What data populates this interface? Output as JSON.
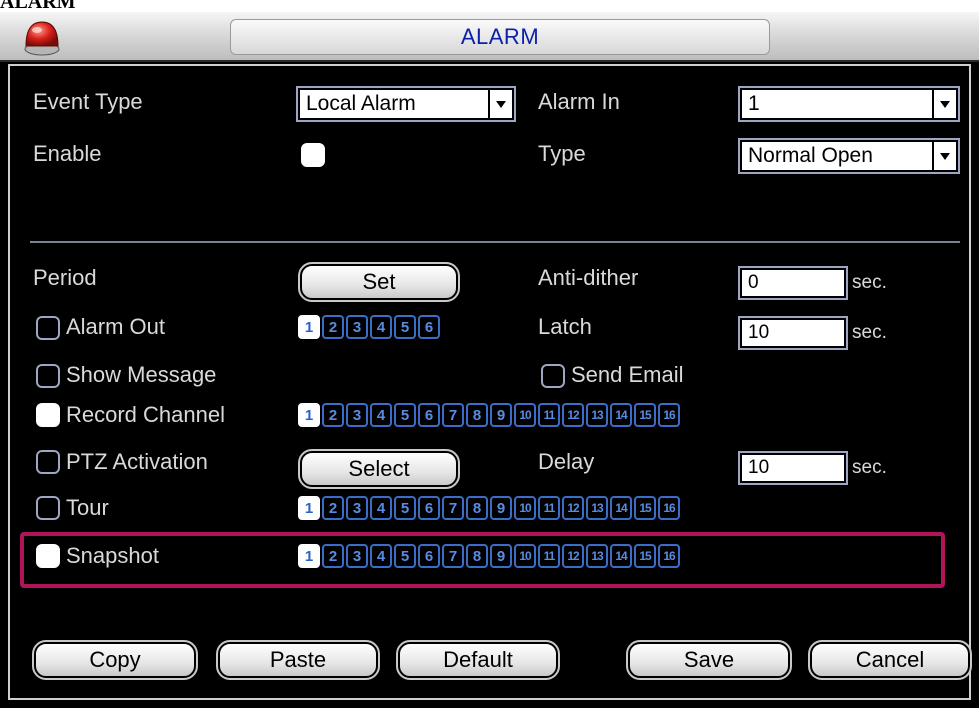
{
  "page_caption": "ALARM",
  "window": {
    "title": "ALARM"
  },
  "event_type": {
    "label": "Event Type",
    "value": "Local Alarm"
  },
  "alarm_in": {
    "label": "Alarm In",
    "value": "1"
  },
  "enable": {
    "label": "Enable",
    "checked": false
  },
  "type": {
    "label": "Type",
    "value": "Normal Open"
  },
  "period": {
    "label": "Period",
    "button": "Set"
  },
  "anti_dither": {
    "label": "Anti-dither",
    "value": "0",
    "unit": "sec."
  },
  "alarm_out": {
    "label": "Alarm Out",
    "channels": [
      "1",
      "2",
      "3",
      "4",
      "5",
      "6"
    ],
    "selected": [
      "1"
    ]
  },
  "latch": {
    "label": "Latch",
    "value": "10",
    "unit": "sec."
  },
  "show_message": {
    "label": "Show Message"
  },
  "send_email": {
    "label": "Send Email"
  },
  "record_channel": {
    "label": "Record Channel",
    "channels": [
      "1",
      "2",
      "3",
      "4",
      "5",
      "6",
      "7",
      "8",
      "9",
      "10",
      "11",
      "12",
      "13",
      "14",
      "15",
      "16"
    ],
    "selected": [
      "1"
    ]
  },
  "ptz_activation": {
    "label": "PTZ Activation",
    "button": "Select"
  },
  "delay": {
    "label": "Delay",
    "value": "10",
    "unit": "sec."
  },
  "tour": {
    "label": "Tour",
    "channels": [
      "1",
      "2",
      "3",
      "4",
      "5",
      "6",
      "7",
      "8",
      "9",
      "10",
      "11",
      "12",
      "13",
      "14",
      "15",
      "16"
    ],
    "selected": [
      "1"
    ]
  },
  "snapshot": {
    "label": "Snapshot",
    "channels": [
      "1",
      "2",
      "3",
      "4",
      "5",
      "6",
      "7",
      "8",
      "9",
      "10",
      "11",
      "12",
      "13",
      "14",
      "15",
      "16"
    ],
    "selected": [
      "1"
    ]
  },
  "buttons": {
    "copy": "Copy",
    "paste": "Paste",
    "default": "Default",
    "save": "Save",
    "cancel": "Cancel"
  },
  "colors": {
    "highlight": "#b0155a",
    "channel_blue": "#3a6dc8",
    "title_text": "#0b1fa8"
  }
}
